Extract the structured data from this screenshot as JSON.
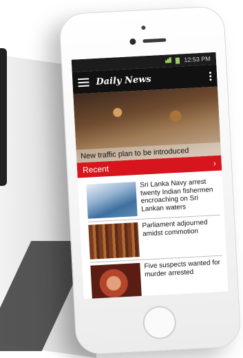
{
  "status_bar": {
    "time": "12:53 PM"
  },
  "app_bar": {
    "title": "Daily News"
  },
  "hero": {
    "caption": "New traffic plan to be introduced"
  },
  "section": {
    "label": "Recent",
    "chevron": "›"
  },
  "articles": [
    {
      "headline": "Sri Lanka Navy arrest twenty Indian fishermen encroaching on Sri Lankan waters",
      "thumb_icon": "ocean-photo"
    },
    {
      "headline": "Parliament adjourned amidst commotion",
      "thumb_icon": "parliament-photo"
    },
    {
      "headline": "Five suspects wanted for murder arrested",
      "thumb_icon": "handcuffs-photo"
    }
  ],
  "colors": {
    "accent": "#d6151d",
    "app_bar": "#111111",
    "status_bar": "#1c1c1c"
  }
}
